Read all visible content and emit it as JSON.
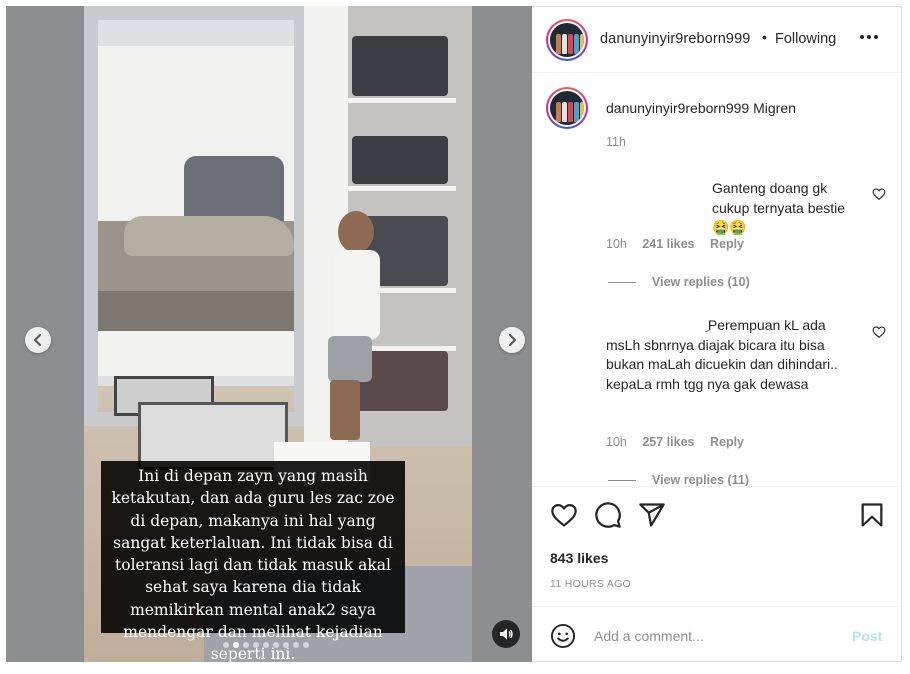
{
  "media": {
    "caption": "Ini di depan zayn yang masih ketakutan, dan ada guru les zac zoe di depan, makanya ini hal yang sangat keterlaluan. Ini tidak bisa di toleransi lagi dan tidak masuk akal sehat saya karena dia tidak memikirkan mental anak2 saya mendengar dan melihat kejadian seperti ini.",
    "carousel": {
      "total": 9,
      "active_index": 1
    }
  },
  "header": {
    "username": "danunyinyir9reborn999",
    "separator": "•",
    "follow_label": "Following",
    "more_icon": "more-horizontal-icon"
  },
  "post_caption": {
    "username": "danunyinyir9reborn999",
    "text": "Migren",
    "time": "11h"
  },
  "comments": [
    {
      "text": "Ganteng doang gk cukup ternyata bestie 🤮🤮",
      "time": "10h",
      "likes": "241 likes",
      "reply_label": "Reply",
      "view_replies": "View replies (10)"
    },
    {
      "text": "ِ Perempuan kL ada msLh sbnrnya diajak bicara itu bisa bukan maLah dicuekin dan dihindari.. kepaLa rmh tgg nya gak dewasa",
      "time": "10h",
      "likes": "257 likes",
      "reply_label": "Reply",
      "view_replies": "View replies (11)"
    }
  ],
  "actions": {
    "like_icon": "heart-icon",
    "comment_icon": "comment-icon",
    "share_icon": "paper-plane-icon",
    "save_icon": "bookmark-icon",
    "likes": "843 likes",
    "posted": "11 HOURS AGO"
  },
  "add_comment": {
    "placeholder": "Add a comment...",
    "post_label": "Post",
    "emoji_icon": "smiley-icon"
  },
  "colors": {
    "text": "#262626",
    "muted": "#8e8e8e",
    "post_disabled": "#b2dffc",
    "border": "#dbdbdb"
  }
}
